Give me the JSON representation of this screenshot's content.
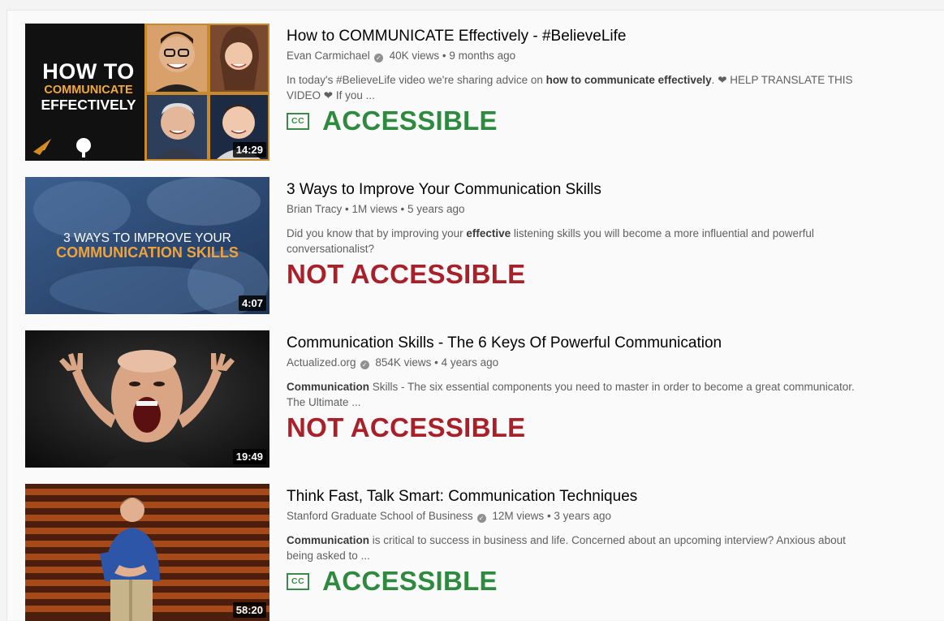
{
  "videos": [
    {
      "title": "How to COMMUNICATE Effectively - #BelieveLife",
      "channel": "Evan Carmichael",
      "verified": true,
      "views": "40K views",
      "age": "9 months ago",
      "desc": {
        "a": "In today's #BelieveLife video we're sharing advice on ",
        "b": "how to communicate effectively",
        "c": ". ",
        "d": " HELP TRANSLATE THIS VIDEO ",
        "e": " If you ..."
      },
      "duration": "14:29",
      "cc": "CC",
      "status": "ACCESSIBLE",
      "thumb": {
        "line1": "HOW TO",
        "line2": "COMMUNICATE",
        "line3": "EFFECTIVELY"
      }
    },
    {
      "title": "3 Ways to Improve Your Communication Skills",
      "channel": "Brian Tracy",
      "verified": false,
      "views": "1M views",
      "age": "5 years ago",
      "desc": {
        "a": "Did you know that by improving your ",
        "b": "effective",
        "c": " listening skills you will become a more influential and powerful conversationalist?"
      },
      "duration": "4:07",
      "status": "NOT ACCESSIBLE",
      "thumb": {
        "line1": "3 WAYS TO IMPROVE YOUR",
        "line2": "COMMUNICATION SKILLS"
      }
    },
    {
      "title": "Communication Skills - The 6 Keys Of Powerful Communication",
      "channel": "Actualized.org",
      "verified": true,
      "views": "854K views",
      "age": "4 years ago",
      "desc": {
        "a": "",
        "b": "Communication",
        "c": " Skills - The six essential components you need to master in order to become a great communicator. The Ultimate ..."
      },
      "duration": "19:49",
      "status": "NOT ACCESSIBLE"
    },
    {
      "title": "Think Fast, Talk Smart: Communication Techniques",
      "channel": "Stanford Graduate School of Business",
      "verified": true,
      "views": "12M views",
      "age": "3 years ago",
      "desc": {
        "a": "",
        "b": "Communication",
        "c": " is critical to success in business and life. Concerned about an upcoming interview? Anxious about being asked to ..."
      },
      "duration": "58:20",
      "cc": "CC",
      "status": "ACCESSIBLE"
    }
  ],
  "separator": " • ",
  "icons": {
    "verified": "check-badge-icon",
    "heart": "heart-icon",
    "cc": "closed-captions-icon"
  },
  "colors": {
    "accessible": "#2e8a3e",
    "not_accessible": "#a8202a"
  }
}
